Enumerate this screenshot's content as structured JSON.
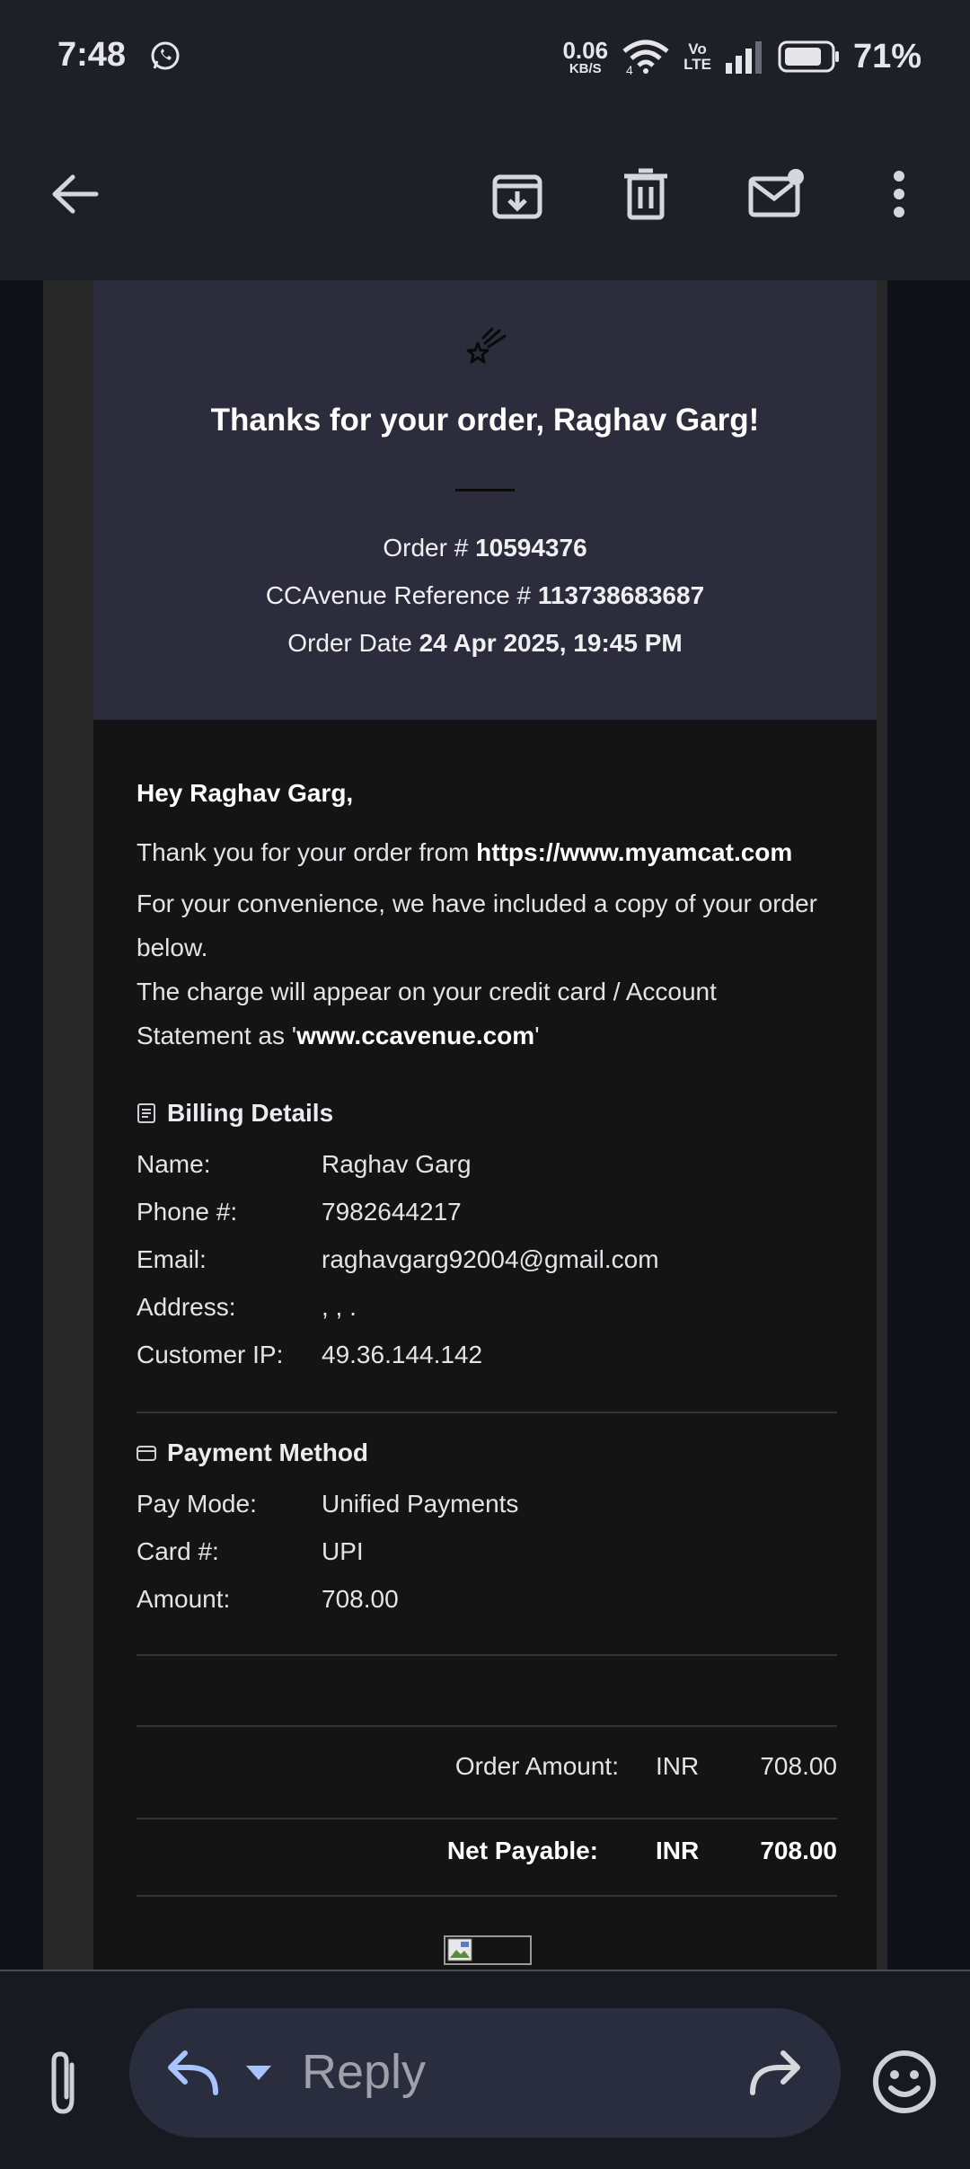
{
  "status_bar": {
    "time": "7:48",
    "net_speed": "0.06",
    "net_unit": "KB/S",
    "network_label": "4",
    "volte_top": "Vo",
    "volte_bottom": "LTE",
    "battery": "71%"
  },
  "toolbar": {
    "icons": [
      "back-arrow-icon",
      "archive-icon",
      "delete-icon",
      "mark-unread-icon",
      "more-vert-icon"
    ]
  },
  "email": {
    "hero": {
      "title": "Thanks for your order, Raghav Garg!",
      "order_label": "Order # ",
      "order_number": "10594376",
      "ref_label": "CCAvenue Reference # ",
      "ref_number": "113738683687",
      "date_label": "Order Date ",
      "date_value": "24 Apr 2025, 19:45 PM"
    },
    "greeting": "Hey Raghav Garg,",
    "thanks_prefix": "Thank you for your order from ",
    "site_url": "https://www.myamcat.com",
    "copy_line_1": "For your convenience, we have included a copy of your order",
    "copy_line_2": "below.",
    "charge_line_1": "The charge will appear on your credit card / Account",
    "charge_prefix": "Statement as '",
    "charge_site": "www.ccavenue.com",
    "charge_suffix": "'",
    "billing": {
      "heading": "Billing Details",
      "rows": [
        {
          "key": "Name:",
          "value": "Raghav Garg"
        },
        {
          "key": "Phone #:",
          "value": "7982644217"
        },
        {
          "key": "Email:",
          "value": "raghavgarg92004@gmail.com"
        },
        {
          "key": "Address:",
          "value": ", , ."
        },
        {
          "key": "Customer IP:",
          "value": "49.36.144.142"
        }
      ]
    },
    "payment": {
      "heading": "Payment Method",
      "rows": [
        {
          "key": "Pay Mode:",
          "value": "Unified Payments"
        },
        {
          "key": "Card #:",
          "value": "UPI"
        },
        {
          "key": "Amount:",
          "value": "708.00"
        }
      ]
    },
    "totals": {
      "order_amount_label": "Order Amount:",
      "order_currency": "INR",
      "order_amount": "708.00",
      "net_label": "Net Payable:",
      "net_currency": "INR",
      "net_amount": "708.00"
    }
  },
  "bottom_bar": {
    "reply_label": "Reply"
  },
  "colors": {
    "background": "#0f1118",
    "bar": "#1e2028",
    "hero": "#2d2c3d",
    "card": "#141414",
    "accent_reply": "#a8c3ff"
  }
}
